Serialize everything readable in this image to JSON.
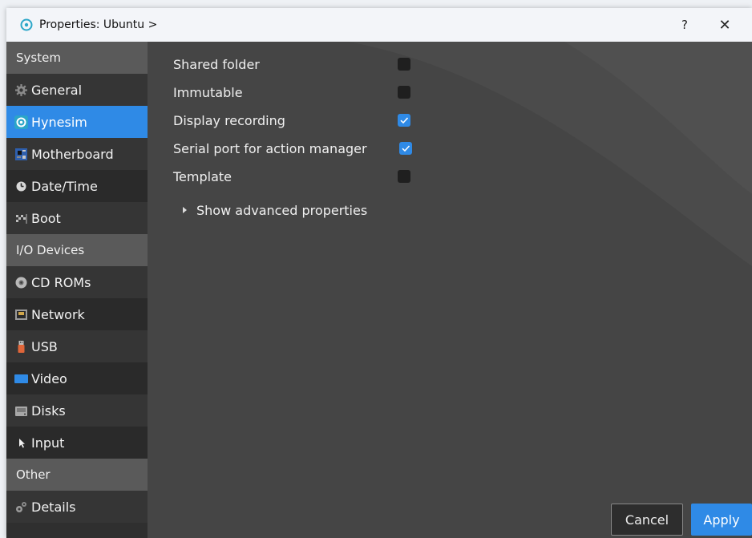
{
  "window": {
    "title": "Properties: Ubuntu >",
    "help_label": "?",
    "close_label": "✕"
  },
  "sidebar": {
    "sections": [
      {
        "header": "System",
        "items": [
          {
            "label": "General",
            "icon": "gear-icon"
          },
          {
            "label": "Hynesim",
            "icon": "hynesim-icon",
            "active": true
          },
          {
            "label": "Motherboard",
            "icon": "motherboard-icon"
          },
          {
            "label": "Date/Time",
            "icon": "clock-icon"
          },
          {
            "label": "Boot",
            "icon": "boot-flag-icon"
          }
        ]
      },
      {
        "header": "I/O Devices",
        "items": [
          {
            "label": "CD ROMs",
            "icon": "cdrom-icon"
          },
          {
            "label": "Network",
            "icon": "network-icon"
          },
          {
            "label": "USB",
            "icon": "usb-icon"
          },
          {
            "label": "Video",
            "icon": "video-icon"
          },
          {
            "label": "Disks",
            "icon": "disk-icon"
          },
          {
            "label": "Input",
            "icon": "cursor-icon"
          }
        ]
      },
      {
        "header": "Other",
        "items": [
          {
            "label": "Details",
            "icon": "details-gears-icon"
          }
        ]
      }
    ]
  },
  "properties": [
    {
      "label": "Shared folder",
      "checked": false
    },
    {
      "label": "Immutable",
      "checked": false
    },
    {
      "label": "Display recording",
      "checked": true
    },
    {
      "label": "Serial port for action manager",
      "checked": true
    },
    {
      "label": "Template",
      "checked": false
    }
  ],
  "advanced": {
    "label": "Show advanced properties"
  },
  "buttons": {
    "cancel": "Cancel",
    "apply": "Apply"
  },
  "colors": {
    "accent": "#2f8ae6",
    "panel": "#454545",
    "sidebar": "#2f2f2f",
    "section_header": "#5a5a5a",
    "titlebar": "#f3f5f9"
  }
}
